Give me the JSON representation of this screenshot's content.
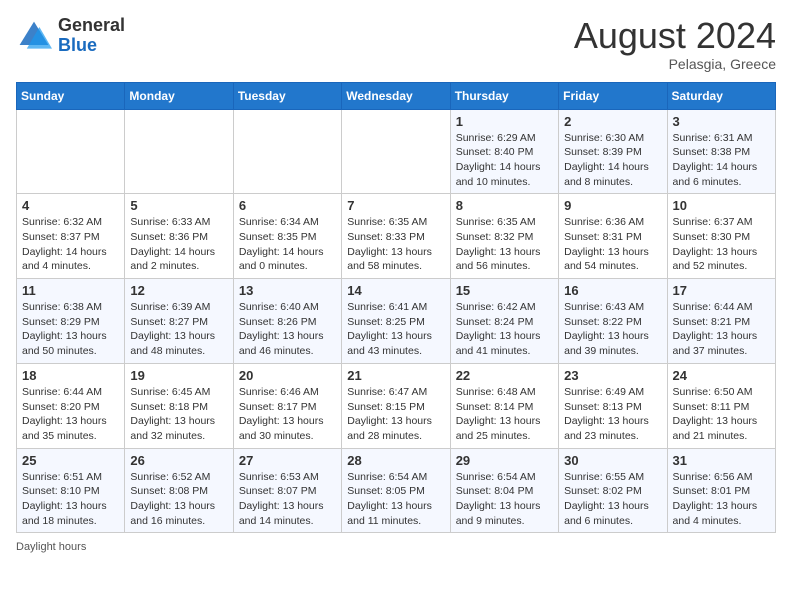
{
  "header": {
    "logo_general": "General",
    "logo_blue": "Blue",
    "month_year": "August 2024",
    "location": "Pelasgia, Greece"
  },
  "days_of_week": [
    "Sunday",
    "Monday",
    "Tuesday",
    "Wednesday",
    "Thursday",
    "Friday",
    "Saturday"
  ],
  "weeks": [
    [
      {
        "day": "",
        "detail": ""
      },
      {
        "day": "",
        "detail": ""
      },
      {
        "day": "",
        "detail": ""
      },
      {
        "day": "",
        "detail": ""
      },
      {
        "day": "1",
        "detail": "Sunrise: 6:29 AM\nSunset: 8:40 PM\nDaylight: 14 hours and 10 minutes."
      },
      {
        "day": "2",
        "detail": "Sunrise: 6:30 AM\nSunset: 8:39 PM\nDaylight: 14 hours and 8 minutes."
      },
      {
        "day": "3",
        "detail": "Sunrise: 6:31 AM\nSunset: 8:38 PM\nDaylight: 14 hours and 6 minutes."
      }
    ],
    [
      {
        "day": "4",
        "detail": "Sunrise: 6:32 AM\nSunset: 8:37 PM\nDaylight: 14 hours and 4 minutes."
      },
      {
        "day": "5",
        "detail": "Sunrise: 6:33 AM\nSunset: 8:36 PM\nDaylight: 14 hours and 2 minutes."
      },
      {
        "day": "6",
        "detail": "Sunrise: 6:34 AM\nSunset: 8:35 PM\nDaylight: 14 hours and 0 minutes."
      },
      {
        "day": "7",
        "detail": "Sunrise: 6:35 AM\nSunset: 8:33 PM\nDaylight: 13 hours and 58 minutes."
      },
      {
        "day": "8",
        "detail": "Sunrise: 6:35 AM\nSunset: 8:32 PM\nDaylight: 13 hours and 56 minutes."
      },
      {
        "day": "9",
        "detail": "Sunrise: 6:36 AM\nSunset: 8:31 PM\nDaylight: 13 hours and 54 minutes."
      },
      {
        "day": "10",
        "detail": "Sunrise: 6:37 AM\nSunset: 8:30 PM\nDaylight: 13 hours and 52 minutes."
      }
    ],
    [
      {
        "day": "11",
        "detail": "Sunrise: 6:38 AM\nSunset: 8:29 PM\nDaylight: 13 hours and 50 minutes."
      },
      {
        "day": "12",
        "detail": "Sunrise: 6:39 AM\nSunset: 8:27 PM\nDaylight: 13 hours and 48 minutes."
      },
      {
        "day": "13",
        "detail": "Sunrise: 6:40 AM\nSunset: 8:26 PM\nDaylight: 13 hours and 46 minutes."
      },
      {
        "day": "14",
        "detail": "Sunrise: 6:41 AM\nSunset: 8:25 PM\nDaylight: 13 hours and 43 minutes."
      },
      {
        "day": "15",
        "detail": "Sunrise: 6:42 AM\nSunset: 8:24 PM\nDaylight: 13 hours and 41 minutes."
      },
      {
        "day": "16",
        "detail": "Sunrise: 6:43 AM\nSunset: 8:22 PM\nDaylight: 13 hours and 39 minutes."
      },
      {
        "day": "17",
        "detail": "Sunrise: 6:44 AM\nSunset: 8:21 PM\nDaylight: 13 hours and 37 minutes."
      }
    ],
    [
      {
        "day": "18",
        "detail": "Sunrise: 6:44 AM\nSunset: 8:20 PM\nDaylight: 13 hours and 35 minutes."
      },
      {
        "day": "19",
        "detail": "Sunrise: 6:45 AM\nSunset: 8:18 PM\nDaylight: 13 hours and 32 minutes."
      },
      {
        "day": "20",
        "detail": "Sunrise: 6:46 AM\nSunset: 8:17 PM\nDaylight: 13 hours and 30 minutes."
      },
      {
        "day": "21",
        "detail": "Sunrise: 6:47 AM\nSunset: 8:15 PM\nDaylight: 13 hours and 28 minutes."
      },
      {
        "day": "22",
        "detail": "Sunrise: 6:48 AM\nSunset: 8:14 PM\nDaylight: 13 hours and 25 minutes."
      },
      {
        "day": "23",
        "detail": "Sunrise: 6:49 AM\nSunset: 8:13 PM\nDaylight: 13 hours and 23 minutes."
      },
      {
        "day": "24",
        "detail": "Sunrise: 6:50 AM\nSunset: 8:11 PM\nDaylight: 13 hours and 21 minutes."
      }
    ],
    [
      {
        "day": "25",
        "detail": "Sunrise: 6:51 AM\nSunset: 8:10 PM\nDaylight: 13 hours and 18 minutes."
      },
      {
        "day": "26",
        "detail": "Sunrise: 6:52 AM\nSunset: 8:08 PM\nDaylight: 13 hours and 16 minutes."
      },
      {
        "day": "27",
        "detail": "Sunrise: 6:53 AM\nSunset: 8:07 PM\nDaylight: 13 hours and 14 minutes."
      },
      {
        "day": "28",
        "detail": "Sunrise: 6:54 AM\nSunset: 8:05 PM\nDaylight: 13 hours and 11 minutes."
      },
      {
        "day": "29",
        "detail": "Sunrise: 6:54 AM\nSunset: 8:04 PM\nDaylight: 13 hours and 9 minutes."
      },
      {
        "day": "30",
        "detail": "Sunrise: 6:55 AM\nSunset: 8:02 PM\nDaylight: 13 hours and 6 minutes."
      },
      {
        "day": "31",
        "detail": "Sunrise: 6:56 AM\nSunset: 8:01 PM\nDaylight: 13 hours and 4 minutes."
      }
    ]
  ],
  "footer": {
    "daylight_note": "Daylight hours"
  }
}
